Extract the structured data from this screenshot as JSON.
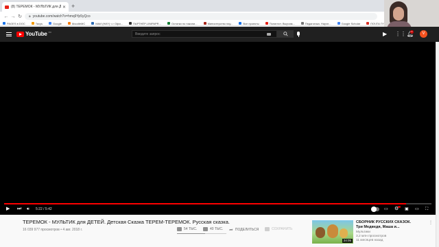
{
  "browser": {
    "tab_title": "(8) ТЕРЕМОК - МУЛЬТИК для Д...",
    "url": "youtube.com/watch?v=hmq9Yp5yQco",
    "bookmarks": [
      {
        "label": "PAGES в DOC",
        "color": "#1a73e8"
      },
      {
        "label": "Taxys",
        "color": "#f29900"
      },
      {
        "label": "Google",
        "color": "#4285f4"
      },
      {
        "label": "MoodleMC",
        "color": "#f98012"
      },
      {
        "label": "МАИ (НИУ) <> Офи...",
        "color": "#2d6bb3"
      },
      {
        "label": "ПАРТНЁР-UNIPAPR...",
        "color": "#333333"
      },
      {
        "label": "Остатки по накопи...",
        "color": "#188038"
      },
      {
        "label": "Министерство нау...",
        "color": "#a8271b"
      },
      {
        "label": "Все проекты",
        "color": "#1a73e8"
      },
      {
        "label": "Полиглот. Выучим...",
        "color": "#e62117"
      },
      {
        "label": "Педагогика. Научн...",
        "color": "#777777"
      },
      {
        "label": "Google Scholar",
        "color": "#4285f4"
      },
      {
        "label": "ПОЧТА ГУПЛ",
        "color": "#d93025"
      },
      {
        "label": "22.12.1997 Д...",
        "color": "#e62117"
      }
    ]
  },
  "youtube": {
    "logo": "YouTube",
    "region": "RU",
    "search_placeholder": "Введите запрос",
    "notifications_count": "9",
    "avatar_letter": "V",
    "accent": "#ff0000"
  },
  "player": {
    "time_current": "5:22",
    "time_total": "5:42",
    "progress": 0.94
  },
  "video": {
    "title": "ТЕРЕМОК - МУЛЬТИК для ДЕТЕЙ. Детская Сказка ТЕРЕМ-ТЕРЕМОК. Русская сказка.",
    "views": "16 039 977 просмотров",
    "date": "4 авг. 2018 г.",
    "likes": "54 ТЫС.",
    "dislikes": "40 ТЫС.",
    "share_label": "ПОДЕЛИТЬСЯ",
    "save_label": "СОХРАНИТЬ",
    "like_ratio": 0.57
  },
  "recommendation": {
    "title_line1": "СБОРНИК РУССКИХ СКАЗОК.",
    "title_line2": "Три Медведя, Маша и...",
    "channel": "Мультики",
    "views": "3,2 млн просмотров",
    "age": "11 месяцев назад",
    "duration": "24:05"
  }
}
